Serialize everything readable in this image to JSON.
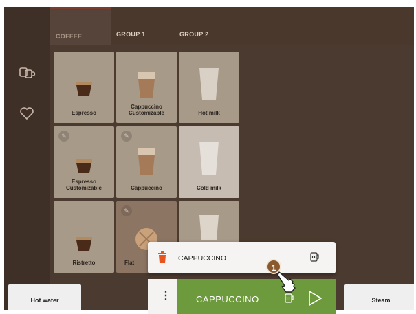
{
  "sidebar": {
    "icons": [
      "cups-icon",
      "heart-icon"
    ]
  },
  "tabs": [
    {
      "label": "COFFEE",
      "active": true
    },
    {
      "label": "GROUP 1",
      "active": false
    },
    {
      "label": "GROUP 2",
      "active": false
    }
  ],
  "products": [
    {
      "label": "Espresso"
    },
    {
      "label": "Cappuccino Customizable"
    },
    {
      "label": "Hot milk"
    },
    {
      "label": "Espresso Customizable"
    },
    {
      "label": "Cappuccino"
    },
    {
      "label": "Cold milk"
    },
    {
      "label": "Ristretto"
    },
    {
      "label": "Flat"
    }
  ],
  "bottom": {
    "hot_water": "Hot water",
    "steam": "Steam"
  },
  "queue_popup": {
    "item_label": "CAPPUCCINO"
  },
  "order_bar": {
    "item_label": "CAPPUCCINO",
    "menu_glyph": "⋮"
  },
  "tutorial": {
    "step": "1"
  },
  "colors": {
    "accent_green": "#6d9a3c",
    "trash_orange": "#e8541c",
    "background": "#4b3a2f"
  }
}
